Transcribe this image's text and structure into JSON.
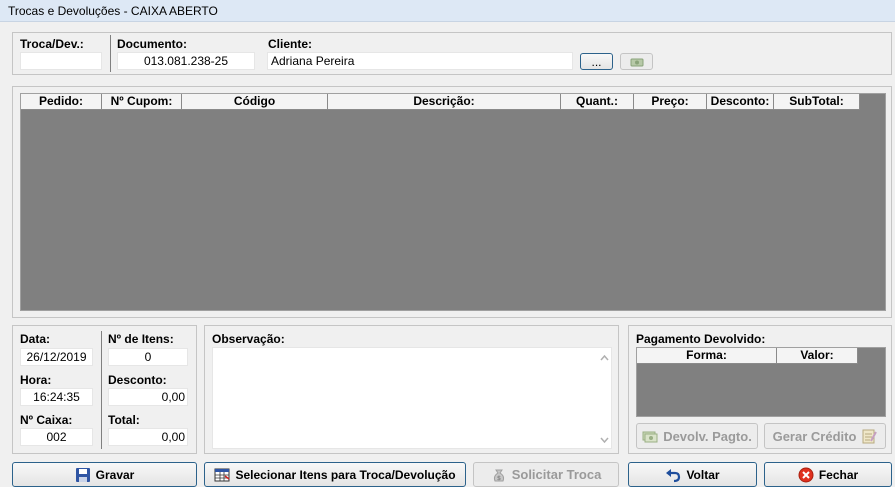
{
  "window": {
    "title": "Trocas e Devoluções - CAIXA ABERTO"
  },
  "header": {
    "troca_label": "Troca/Dev.:",
    "troca_value": "",
    "documento_label": "Documento:",
    "documento_value": "013.081.238-25",
    "cliente_label": "Cliente:",
    "cliente_value": "Adriana Pereira",
    "browse_label": "..."
  },
  "items_grid": {
    "columns": [
      "Pedido:",
      "Nº Cupom:",
      "Código",
      "Descrição:",
      "Quant.:",
      "Preço:",
      "Desconto:",
      "SubTotal:"
    ]
  },
  "summary": {
    "data_label": "Data:",
    "data_value": "26/12/2019",
    "hora_label": "Hora:",
    "hora_value": "16:24:35",
    "caixa_label": "Nº Caixa:",
    "caixa_value": "002",
    "itens_label": "Nº de Itens:",
    "itens_value": "0",
    "desconto_label": "Desconto:",
    "desconto_value": "0,00",
    "total_label": "Total:",
    "total_value": "0,00"
  },
  "observacao": {
    "label": "Observação:",
    "value": ""
  },
  "pagamento": {
    "label": "Pagamento Devolvido:",
    "columns": [
      "Forma:",
      "Valor:"
    ],
    "devolv_button": "Devolv. Pagto.",
    "credito_button": "Gerar Crédito"
  },
  "actions": {
    "gravar": "Gravar",
    "selecionar": "Selecionar Itens para Troca/Devolução",
    "solicitar": "Solicitar Troca",
    "voltar": "Voltar",
    "fechar": "Fechar"
  },
  "colors": {
    "grid_background": "#808080",
    "titlebar": "#dde8f5",
    "fechar_icon": "#e0301e",
    "voltar_icon": "#1f4e9c"
  }
}
